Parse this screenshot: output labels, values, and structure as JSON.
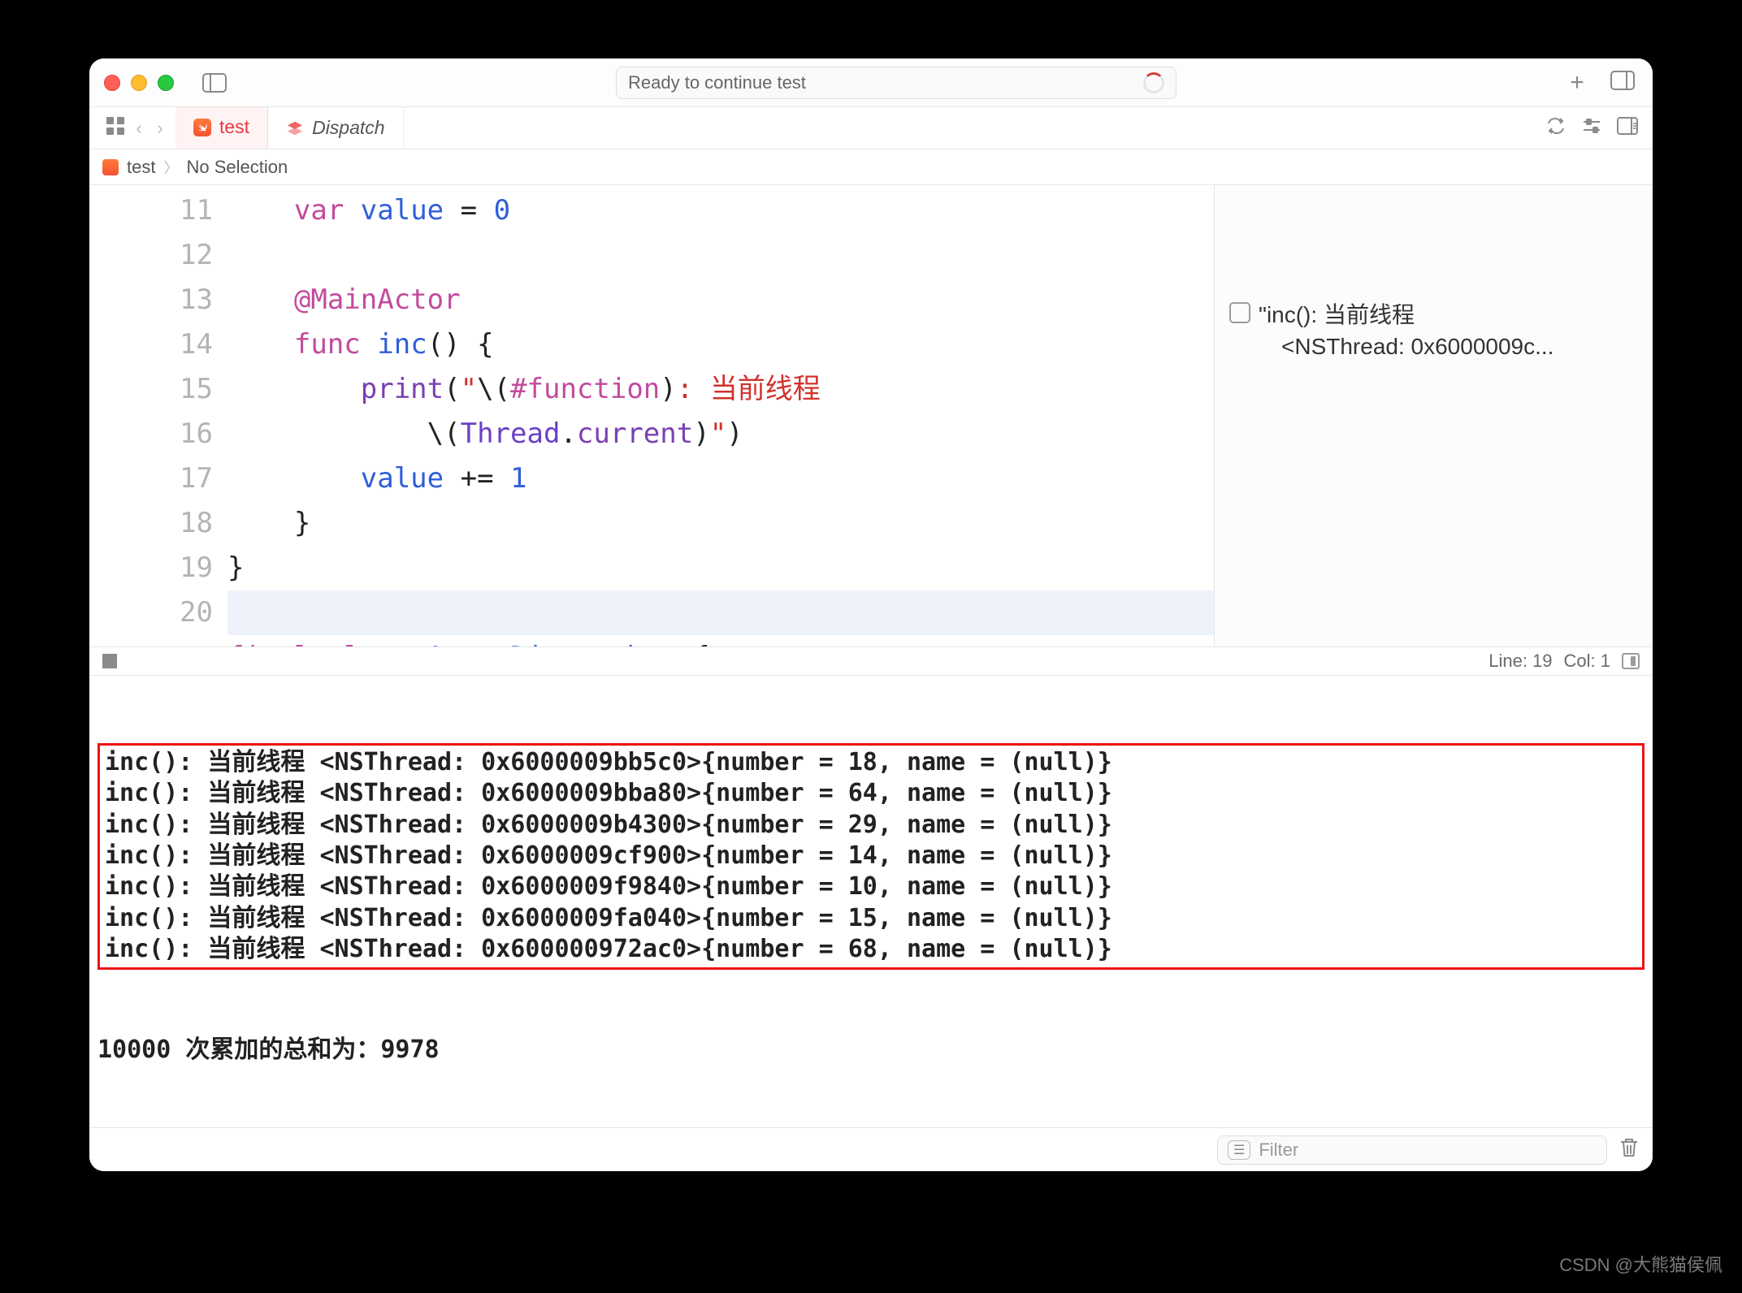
{
  "titlebar": {
    "address_text": "Ready to continue test",
    "plus": "+"
  },
  "tabs": {
    "active_label": "test",
    "dispatch_label": "Dispatch"
  },
  "breadcrumbs": {
    "file": "test",
    "selection": "No Selection"
  },
  "code": {
    "lines": [
      {
        "n": "11",
        "html": "    <span class='k-var'>var</span> <span class='id'>value</span> <span class='black'>=</span> <span class='num'>0</span>"
      },
      {
        "n": "12",
        "html": ""
      },
      {
        "n": "13",
        "html": "    <span class='attr'>@MainActor</span>"
      },
      {
        "n": "14",
        "html": "    <span class='k-func'>func</span> <span class='id'>inc</span><span class='black'>() {</span>"
      },
      {
        "n": "15",
        "html": "        <span class='call'>print</span><span class='black'>(</span><span class='str'>\"</span><span class='black'>\\(</span><span class='attr'>#function</span><span class='black'>)</span><span class='str'>: 当前线程</span>"
      },
      {
        "n": "",
        "html": "            <span class='black'>\\(</span><span class='type'>Thread</span><span class='black'>.</span><span class='prop'>current</span><span class='black'>)</span><span class='str'>\"</span><span class='black'>)</span>"
      },
      {
        "n": "16",
        "html": "        <span class='id'>value</span> <span class='black'>+=</span> <span class='num'>1</span>"
      },
      {
        "n": "17",
        "html": "    <span class='black'>}</span>"
      },
      {
        "n": "18",
        "html": "<span class='black'>}</span>"
      },
      {
        "n": "19",
        "html": "",
        "cursor": true
      },
      {
        "n": "20",
        "html": "<span class='k-final'>final</span> <span class='k-class'>class</span> <span class='id'>ActorDispatcher</span> <span class='black'>{</span>"
      }
    ]
  },
  "preview": {
    "line1": "\"inc(): 当前线程",
    "line2": "<NSThread: 0x6000009c..."
  },
  "status": {
    "line": "Line: 19",
    "col": "Col: 1"
  },
  "console": {
    "boxed": [
      "inc(): 当前线程 <NSThread: 0x6000009bb5c0>{number = 18, name = (null)}",
      "inc(): 当前线程 <NSThread: 0x6000009bba80>{number = 64, name = (null)}",
      "inc(): 当前线程 <NSThread: 0x6000009b4300>{number = 29, name = (null)}",
      "inc(): 当前线程 <NSThread: 0x6000009cf900>{number = 14, name = (null)}",
      "inc(): 当前线程 <NSThread: 0x6000009f9840>{number = 10, name = (null)}",
      "inc(): 当前线程 <NSThread: 0x6000009fa040>{number = 15, name = (null)}",
      "inc(): 当前线程 <NSThread: 0x600000972ac0>{number = 68, name = (null)}"
    ],
    "summary": "10000 次累加的总和为：9978"
  },
  "console_footer": {
    "filter_chip": "☰",
    "filter_placeholder": "Filter"
  },
  "watermark": "CSDN @大熊猫侯佩"
}
